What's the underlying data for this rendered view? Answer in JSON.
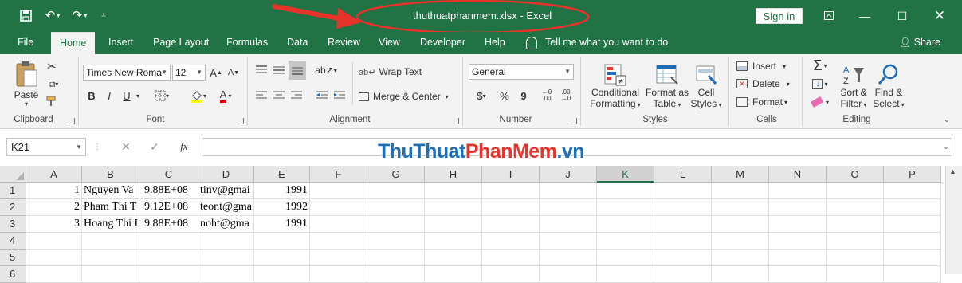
{
  "titlebar": {
    "title": "thuthuatphanmem.xlsx  -  Excel",
    "signin": "Sign in",
    "icons": [
      "save-icon",
      "undo-icon",
      "redo-icon",
      "customize-qat-icon",
      "ribbon-display-icon",
      "minimize-icon",
      "maximize-icon",
      "close-icon"
    ]
  },
  "tabs": {
    "file": "File",
    "home": "Home",
    "insert": "Insert",
    "page_layout": "Page Layout",
    "formulas": "Formulas",
    "data": "Data",
    "review": "Review",
    "view": "View",
    "developer": "Developer",
    "help": "Help",
    "tellme": "Tell me what you want to do",
    "share": "Share"
  },
  "ribbon": {
    "clipboard": {
      "label": "Clipboard",
      "paste": "Paste"
    },
    "font": {
      "label": "Font",
      "family": "Times New Roma",
      "size": "12",
      "bold": "B",
      "italic": "I",
      "underline": "U"
    },
    "alignment": {
      "label": "Alignment",
      "wrap": "Wrap Text",
      "merge": "Merge & Center"
    },
    "number": {
      "label": "Number",
      "format": "General",
      "currency": "$",
      "percent": "%",
      "comma": "9"
    },
    "styles": {
      "label": "Styles",
      "cond1": "Conditional",
      "cond2": "Formatting",
      "fmt1": "Format as",
      "fmt2": "Table",
      "cell1": "Cell",
      "cell2": "Styles"
    },
    "cells": {
      "label": "Cells",
      "insert": "Insert",
      "delete": "Delete",
      "format": "Format"
    },
    "editing": {
      "label": "Editing",
      "sort1": "Sort &",
      "sort2": "Filter",
      "find1": "Find &",
      "find2": "Select"
    }
  },
  "formula_bar": {
    "name_box": "K21",
    "fx": "fx",
    "value": ""
  },
  "watermark": {
    "part1": "ThuThuat",
    "part2": "PhanMem",
    "part3": ".vn"
  },
  "sheet": {
    "columns": [
      "A",
      "B",
      "C",
      "D",
      "E",
      "F",
      "G",
      "H",
      "I",
      "J",
      "K",
      "L",
      "M",
      "N",
      "O",
      "P"
    ],
    "selected_column": "K",
    "rows": [
      "1",
      "2",
      "3",
      "4",
      "5",
      "6"
    ],
    "data": [
      [
        "1",
        "Nguyen Va",
        "9.88E+08",
        "tinv@gmai",
        "1991"
      ],
      [
        "2",
        "Pham Thi T",
        "9.12E+08",
        "teont@gma",
        "1992"
      ],
      [
        "3",
        "Hoang Thi I",
        "9.88E+08",
        "noht@gma",
        "1991"
      ]
    ]
  },
  "colors": {
    "excel_green": "#217346",
    "annotation_red": "#e8332b",
    "watermark_blue": "#1d6fb8",
    "watermark_red": "#e8332b"
  }
}
